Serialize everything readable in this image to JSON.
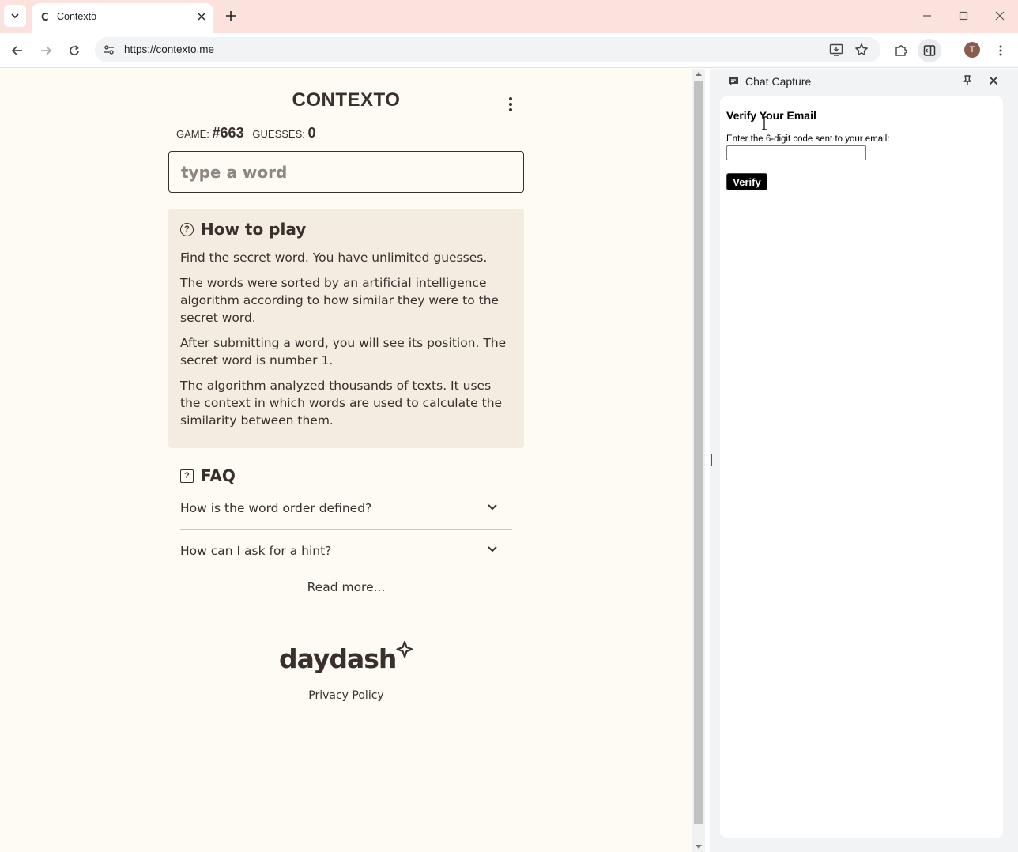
{
  "browser": {
    "tab_title": "Contexto",
    "tab_favicon": "C",
    "url": "https://contexto.me",
    "profile_initial": "T"
  },
  "game": {
    "title": "CONTEXTO",
    "game_label": "GAME:",
    "game_number": "#663",
    "guesses_label": "GUESSES:",
    "guesses_count": "0",
    "input_placeholder": "type a word"
  },
  "how_to_play": {
    "heading": "How to play",
    "paragraphs": [
      "Find the secret word. You have unlimited guesses.",
      "The words were sorted by an artificial intelligence algorithm according to how similar they were to the secret word.",
      "After submitting a word, you will see its position. The secret word is number 1.",
      "The algorithm analyzed thousands of texts. It uses the context in which words are used to calculate the similarity between them."
    ]
  },
  "faq": {
    "heading": "FAQ",
    "items": [
      "How is the word order defined?",
      "How can I ask for a hint?"
    ],
    "read_more": "Read more..."
  },
  "footer": {
    "logo_text": "daydash",
    "privacy": "Privacy Policy"
  },
  "side_panel": {
    "title": "Chat Capture",
    "verify_title": "Verify Your Email",
    "verify_label": "Enter the 6-digit code sent to your email:",
    "code_value": "",
    "verify_button": "Verify"
  },
  "colors": {
    "tab_strip": "#fce2dc",
    "page_bg": "#fefbf2",
    "card_bg": "#f2ece1",
    "text": "#3a2f2c"
  }
}
